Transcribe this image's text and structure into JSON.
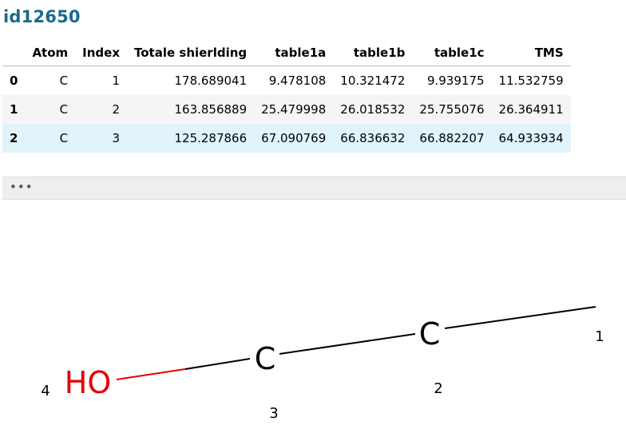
{
  "title": "id12650",
  "table": {
    "columns": [
      "",
      "Atom",
      "Index",
      "Totale shierlding",
      "table1a",
      "table1b",
      "table1c",
      "TMS"
    ],
    "rows": [
      {
        "index": "0",
        "atom": "C",
        "idx": "1",
        "shielding": "178.689041",
        "t1a": "9.478108",
        "t1b": "10.321472",
        "t1c": "9.939175",
        "tms": "11.532759"
      },
      {
        "index": "1",
        "atom": "C",
        "idx": "2",
        "shielding": "163.856889",
        "t1a": "25.479998",
        "t1b": "26.018532",
        "t1c": "25.755076",
        "tms": "26.364911"
      },
      {
        "index": "2",
        "atom": "C",
        "idx": "3",
        "shielding": "125.287866",
        "t1a": "67.090769",
        "t1b": "66.836632",
        "t1c": "66.882207",
        "tms": "64.933934"
      }
    ]
  },
  "expander_label": "•••",
  "molecule": {
    "atom_labels": {
      "c2": "C",
      "c3": "C",
      "oh": "HO"
    },
    "index_labels": {
      "n1": "1",
      "n2": "2",
      "n3": "3",
      "n4": "4"
    },
    "colors": {
      "bond": "#000000",
      "oxygen": "#e60000"
    }
  }
}
